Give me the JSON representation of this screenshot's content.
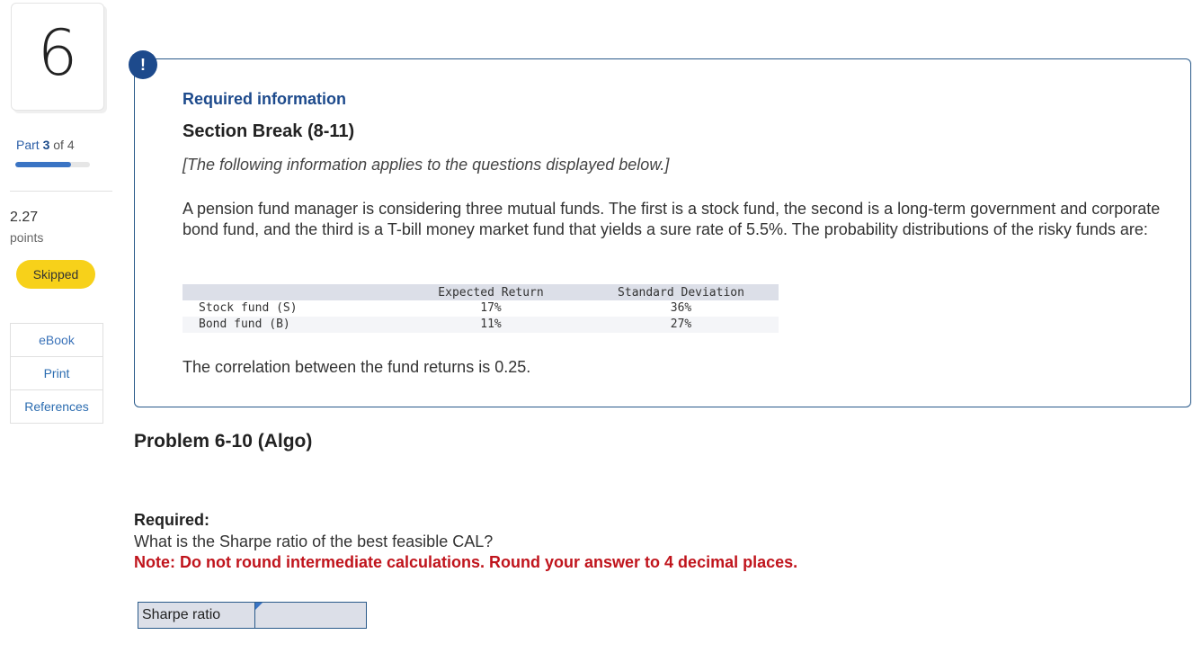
{
  "question": {
    "number": "6",
    "part_prefix": "Part",
    "part_current": "3",
    "part_of": "of",
    "part_total": "4",
    "progress_fraction": 0.75,
    "points_value": "2.27",
    "points_label": "points",
    "status_badge": "Skipped"
  },
  "resources": {
    "items": [
      {
        "label": "eBook"
      },
      {
        "label": "Print"
      },
      {
        "label": "References"
      }
    ]
  },
  "info_box": {
    "icon": "!",
    "heading": "Required information",
    "section_break": "Section Break (8-11)",
    "italic_note": "[The following information applies to the questions displayed below.]",
    "paragraph": "A pension fund manager is considering three mutual funds. The first is a stock fund, the second is a long-term government and corporate bond fund, and the third is a T-bill money market fund that yields a sure rate of 5.5%. The probability distributions of the risky funds are:",
    "table": {
      "headers": [
        "",
        "Expected Return",
        "Standard Deviation"
      ],
      "rows": [
        {
          "label": "Stock fund (S)",
          "expected_return": "17%",
          "std_dev": "36%"
        },
        {
          "label": "Bond fund (B)",
          "expected_return": "11%",
          "std_dev": "27%"
        }
      ]
    },
    "correlation_text": "The correlation between the fund returns is 0.25."
  },
  "problem": {
    "title": "Problem 6-10 (Algo)",
    "required_heading": "Required:",
    "question_text": "What is the Sharpe ratio of the best feasible CAL?",
    "note_text": "Note: Do not round intermediate calculations. Round your answer to 4 decimal places.",
    "answer_label": "Sharpe ratio",
    "answer_value": ""
  },
  "colors": {
    "accent_blue": "#1d4a8c",
    "link_blue": "#2b6cb0",
    "note_red": "#c0141c",
    "badge_yellow": "#f7d11a"
  }
}
